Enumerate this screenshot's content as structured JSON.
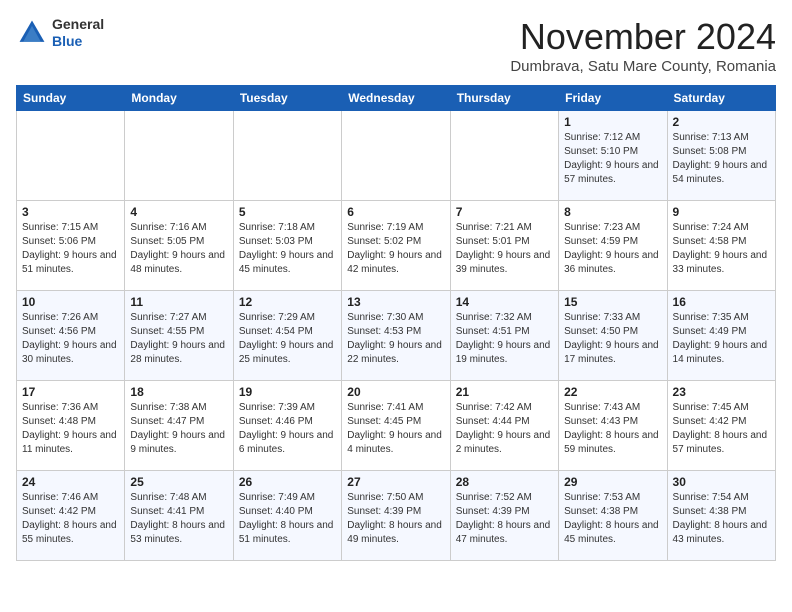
{
  "logo": {
    "general": "General",
    "blue": "Blue"
  },
  "title": "November 2024",
  "location": "Dumbrava, Satu Mare County, Romania",
  "weekdays": [
    "Sunday",
    "Monday",
    "Tuesday",
    "Wednesday",
    "Thursday",
    "Friday",
    "Saturday"
  ],
  "weeks": [
    [
      {
        "day": "",
        "info": ""
      },
      {
        "day": "",
        "info": ""
      },
      {
        "day": "",
        "info": ""
      },
      {
        "day": "",
        "info": ""
      },
      {
        "day": "",
        "info": ""
      },
      {
        "day": "1",
        "info": "Sunrise: 7:12 AM\nSunset: 5:10 PM\nDaylight: 9 hours and 57 minutes."
      },
      {
        "day": "2",
        "info": "Sunrise: 7:13 AM\nSunset: 5:08 PM\nDaylight: 9 hours and 54 minutes."
      }
    ],
    [
      {
        "day": "3",
        "info": "Sunrise: 7:15 AM\nSunset: 5:06 PM\nDaylight: 9 hours and 51 minutes."
      },
      {
        "day": "4",
        "info": "Sunrise: 7:16 AM\nSunset: 5:05 PM\nDaylight: 9 hours and 48 minutes."
      },
      {
        "day": "5",
        "info": "Sunrise: 7:18 AM\nSunset: 5:03 PM\nDaylight: 9 hours and 45 minutes."
      },
      {
        "day": "6",
        "info": "Sunrise: 7:19 AM\nSunset: 5:02 PM\nDaylight: 9 hours and 42 minutes."
      },
      {
        "day": "7",
        "info": "Sunrise: 7:21 AM\nSunset: 5:01 PM\nDaylight: 9 hours and 39 minutes."
      },
      {
        "day": "8",
        "info": "Sunrise: 7:23 AM\nSunset: 4:59 PM\nDaylight: 9 hours and 36 minutes."
      },
      {
        "day": "9",
        "info": "Sunrise: 7:24 AM\nSunset: 4:58 PM\nDaylight: 9 hours and 33 minutes."
      }
    ],
    [
      {
        "day": "10",
        "info": "Sunrise: 7:26 AM\nSunset: 4:56 PM\nDaylight: 9 hours and 30 minutes."
      },
      {
        "day": "11",
        "info": "Sunrise: 7:27 AM\nSunset: 4:55 PM\nDaylight: 9 hours and 28 minutes."
      },
      {
        "day": "12",
        "info": "Sunrise: 7:29 AM\nSunset: 4:54 PM\nDaylight: 9 hours and 25 minutes."
      },
      {
        "day": "13",
        "info": "Sunrise: 7:30 AM\nSunset: 4:53 PM\nDaylight: 9 hours and 22 minutes."
      },
      {
        "day": "14",
        "info": "Sunrise: 7:32 AM\nSunset: 4:51 PM\nDaylight: 9 hours and 19 minutes."
      },
      {
        "day": "15",
        "info": "Sunrise: 7:33 AM\nSunset: 4:50 PM\nDaylight: 9 hours and 17 minutes."
      },
      {
        "day": "16",
        "info": "Sunrise: 7:35 AM\nSunset: 4:49 PM\nDaylight: 9 hours and 14 minutes."
      }
    ],
    [
      {
        "day": "17",
        "info": "Sunrise: 7:36 AM\nSunset: 4:48 PM\nDaylight: 9 hours and 11 minutes."
      },
      {
        "day": "18",
        "info": "Sunrise: 7:38 AM\nSunset: 4:47 PM\nDaylight: 9 hours and 9 minutes."
      },
      {
        "day": "19",
        "info": "Sunrise: 7:39 AM\nSunset: 4:46 PM\nDaylight: 9 hours and 6 minutes."
      },
      {
        "day": "20",
        "info": "Sunrise: 7:41 AM\nSunset: 4:45 PM\nDaylight: 9 hours and 4 minutes."
      },
      {
        "day": "21",
        "info": "Sunrise: 7:42 AM\nSunset: 4:44 PM\nDaylight: 9 hours and 2 minutes."
      },
      {
        "day": "22",
        "info": "Sunrise: 7:43 AM\nSunset: 4:43 PM\nDaylight: 8 hours and 59 minutes."
      },
      {
        "day": "23",
        "info": "Sunrise: 7:45 AM\nSunset: 4:42 PM\nDaylight: 8 hours and 57 minutes."
      }
    ],
    [
      {
        "day": "24",
        "info": "Sunrise: 7:46 AM\nSunset: 4:42 PM\nDaylight: 8 hours and 55 minutes."
      },
      {
        "day": "25",
        "info": "Sunrise: 7:48 AM\nSunset: 4:41 PM\nDaylight: 8 hours and 53 minutes."
      },
      {
        "day": "26",
        "info": "Sunrise: 7:49 AM\nSunset: 4:40 PM\nDaylight: 8 hours and 51 minutes."
      },
      {
        "day": "27",
        "info": "Sunrise: 7:50 AM\nSunset: 4:39 PM\nDaylight: 8 hours and 49 minutes."
      },
      {
        "day": "28",
        "info": "Sunrise: 7:52 AM\nSunset: 4:39 PM\nDaylight: 8 hours and 47 minutes."
      },
      {
        "day": "29",
        "info": "Sunrise: 7:53 AM\nSunset: 4:38 PM\nDaylight: 8 hours and 45 minutes."
      },
      {
        "day": "30",
        "info": "Sunrise: 7:54 AM\nSunset: 4:38 PM\nDaylight: 8 hours and 43 minutes."
      }
    ]
  ]
}
